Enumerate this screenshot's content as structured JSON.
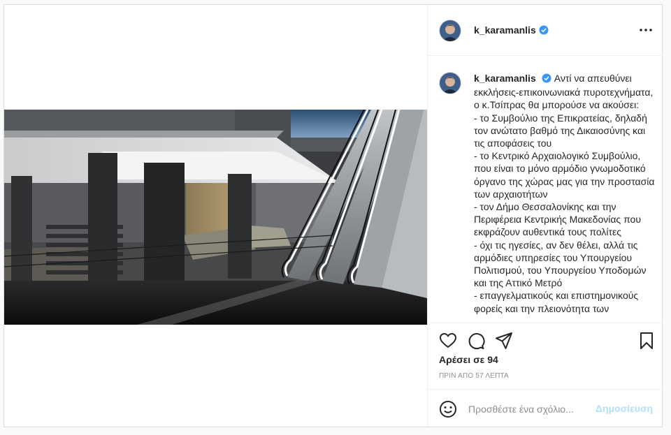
{
  "post": {
    "username": "k_karamanlis",
    "caption_text": "Αντί να απευθύνει εκκλήσεις-επικοινωνιακά πυροτεχνήματα, ο κ.Τσίπρας θα μπορούσε να ακούσει:\n- το Συμβούλιο της Επικρατείας, δηλαδή τον ανώτατο βαθμό της Δικαιοσύνης και τις αποφάσεις του\n- το Κεντρικό Αρχαιολογικό Συμβούλιο, που είναι το μόνο αρμόδιο γνωμοδοτικό όργανο της χώρας μας για την προστασία των αρχαιοτήτων\n- τον Δήμο Θεσσαλονίκης και την Περιφέρεια Κεντρικής Μακεδονίας που εκφράζουν αυθεντικά τους πολίτες\n- όχι τις ηγεσίες, αν δεν θέλει, αλλά τις αρμόδιες υπηρεσίες του Υπουργείου Πολιτισμού, του Υπουργείου Υποδομών και της Αττικό Μετρό\n- επαγγελματικούς και επιστημονικούς φορείς και την πλειονότητα των",
    "likes": "Αρέσει σε 94",
    "timestamp": "ΠΡΙΝ ΑΠΟ 57 ΛΕΠΤΑ"
  },
  "comment_box": {
    "placeholder": "Προσθέστε ένα σχόλιο...",
    "post_label": "Δημοσίευση"
  },
  "colors": {
    "verified": "#3897f0",
    "post_button_disabled": "#b2dffc",
    "border": "#dbdbdb"
  },
  "icons": [
    "more-options-icon",
    "verified-badge-icon",
    "heart-icon",
    "comment-icon",
    "share-icon",
    "bookmark-icon",
    "emoji-icon"
  ]
}
